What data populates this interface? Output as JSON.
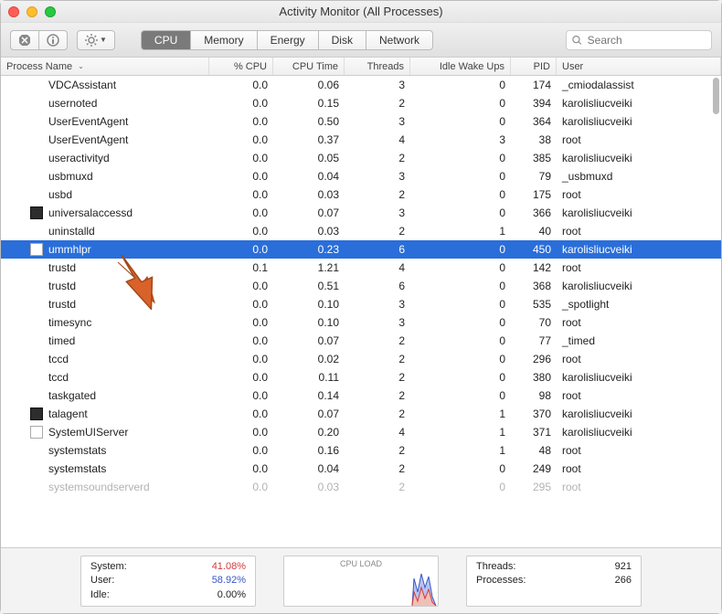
{
  "window": {
    "title": "Activity Monitor (All Processes)"
  },
  "search": {
    "placeholder": "Search"
  },
  "tabs": {
    "cpu": "CPU",
    "memory": "Memory",
    "energy": "Energy",
    "disk": "Disk",
    "network": "Network"
  },
  "columns": {
    "name": "Process Name",
    "cpu": "% CPU",
    "time": "CPU Time",
    "threads": "Threads",
    "wake": "Idle Wake Ups",
    "pid": "PID",
    "user": "User"
  },
  "processes": [
    {
      "name": "VDCAssistant",
      "cpu": "0.0",
      "time": "0.06",
      "threads": "3",
      "wake": "0",
      "pid": "174",
      "user": "_cmiodalassist",
      "icon": ""
    },
    {
      "name": "usernoted",
      "cpu": "0.0",
      "time": "0.15",
      "threads": "2",
      "wake": "0",
      "pid": "394",
      "user": "karolisliucveiki",
      "icon": ""
    },
    {
      "name": "UserEventAgent",
      "cpu": "0.0",
      "time": "0.50",
      "threads": "3",
      "wake": "0",
      "pid": "364",
      "user": "karolisliucveiki",
      "icon": ""
    },
    {
      "name": "UserEventAgent",
      "cpu": "0.0",
      "time": "0.37",
      "threads": "4",
      "wake": "3",
      "pid": "38",
      "user": "root",
      "icon": ""
    },
    {
      "name": "useractivityd",
      "cpu": "0.0",
      "time": "0.05",
      "threads": "2",
      "wake": "0",
      "pid": "385",
      "user": "karolisliucveiki",
      "icon": ""
    },
    {
      "name": "usbmuxd",
      "cpu": "0.0",
      "time": "0.04",
      "threads": "3",
      "wake": "0",
      "pid": "79",
      "user": "_usbmuxd",
      "icon": ""
    },
    {
      "name": "usbd",
      "cpu": "0.0",
      "time": "0.03",
      "threads": "2",
      "wake": "0",
      "pid": "175",
      "user": "root",
      "icon": ""
    },
    {
      "name": "universalaccessd",
      "cpu": "0.0",
      "time": "0.07",
      "threads": "3",
      "wake": "0",
      "pid": "366",
      "user": "karolisliucveiki",
      "icon": "dark"
    },
    {
      "name": "uninstalld",
      "cpu": "0.0",
      "time": "0.03",
      "threads": "2",
      "wake": "1",
      "pid": "40",
      "user": "root",
      "icon": ""
    },
    {
      "name": "ummhlpr",
      "cpu": "0.0",
      "time": "0.23",
      "threads": "6",
      "wake": "0",
      "pid": "450",
      "user": "karolisliucveiki",
      "icon": "doc",
      "selected": true
    },
    {
      "name": "trustd",
      "cpu": "0.1",
      "time": "1.21",
      "threads": "4",
      "wake": "0",
      "pid": "142",
      "user": "root",
      "icon": ""
    },
    {
      "name": "trustd",
      "cpu": "0.0",
      "time": "0.51",
      "threads": "6",
      "wake": "0",
      "pid": "368",
      "user": "karolisliucveiki",
      "icon": ""
    },
    {
      "name": "trustd",
      "cpu": "0.0",
      "time": "0.10",
      "threads": "3",
      "wake": "0",
      "pid": "535",
      "user": "_spotlight",
      "icon": ""
    },
    {
      "name": "timesync",
      "cpu": "0.0",
      "time": "0.10",
      "threads": "3",
      "wake": "0",
      "pid": "70",
      "user": "root",
      "icon": ""
    },
    {
      "name": "timed",
      "cpu": "0.0",
      "time": "0.07",
      "threads": "2",
      "wake": "0",
      "pid": "77",
      "user": "_timed",
      "icon": ""
    },
    {
      "name": "tccd",
      "cpu": "0.0",
      "time": "0.02",
      "threads": "2",
      "wake": "0",
      "pid": "296",
      "user": "root",
      "icon": ""
    },
    {
      "name": "tccd",
      "cpu": "0.0",
      "time": "0.11",
      "threads": "2",
      "wake": "0",
      "pid": "380",
      "user": "karolisliucveiki",
      "icon": ""
    },
    {
      "name": "taskgated",
      "cpu": "0.0",
      "time": "0.14",
      "threads": "2",
      "wake": "0",
      "pid": "98",
      "user": "root",
      "icon": ""
    },
    {
      "name": "talagent",
      "cpu": "0.0",
      "time": "0.07",
      "threads": "2",
      "wake": "1",
      "pid": "370",
      "user": "karolisliucveiki",
      "icon": "dark"
    },
    {
      "name": "SystemUIServer",
      "cpu": "0.0",
      "time": "0.20",
      "threads": "4",
      "wake": "1",
      "pid": "371",
      "user": "karolisliucveiki",
      "icon": "doc"
    },
    {
      "name": "systemstats",
      "cpu": "0.0",
      "time": "0.16",
      "threads": "2",
      "wake": "1",
      "pid": "48",
      "user": "root",
      "icon": ""
    },
    {
      "name": "systemstats",
      "cpu": "0.0",
      "time": "0.04",
      "threads": "2",
      "wake": "0",
      "pid": "249",
      "user": "root",
      "icon": ""
    },
    {
      "name": "systemsoundserverd",
      "cpu": "0.0",
      "time": "0.03",
      "threads": "2",
      "wake": "0",
      "pid": "295",
      "user": "root",
      "icon": "",
      "cut": true
    }
  ],
  "footer": {
    "system_label": "System:",
    "system_value": "41.08%",
    "user_label": "User:",
    "user_value": "58.92%",
    "idle_label": "Idle:",
    "idle_value": "0.00%",
    "load_label": "CPU LOAD",
    "threads_label": "Threads:",
    "threads_value": "921",
    "processes_label": "Processes:",
    "processes_value": "266"
  }
}
